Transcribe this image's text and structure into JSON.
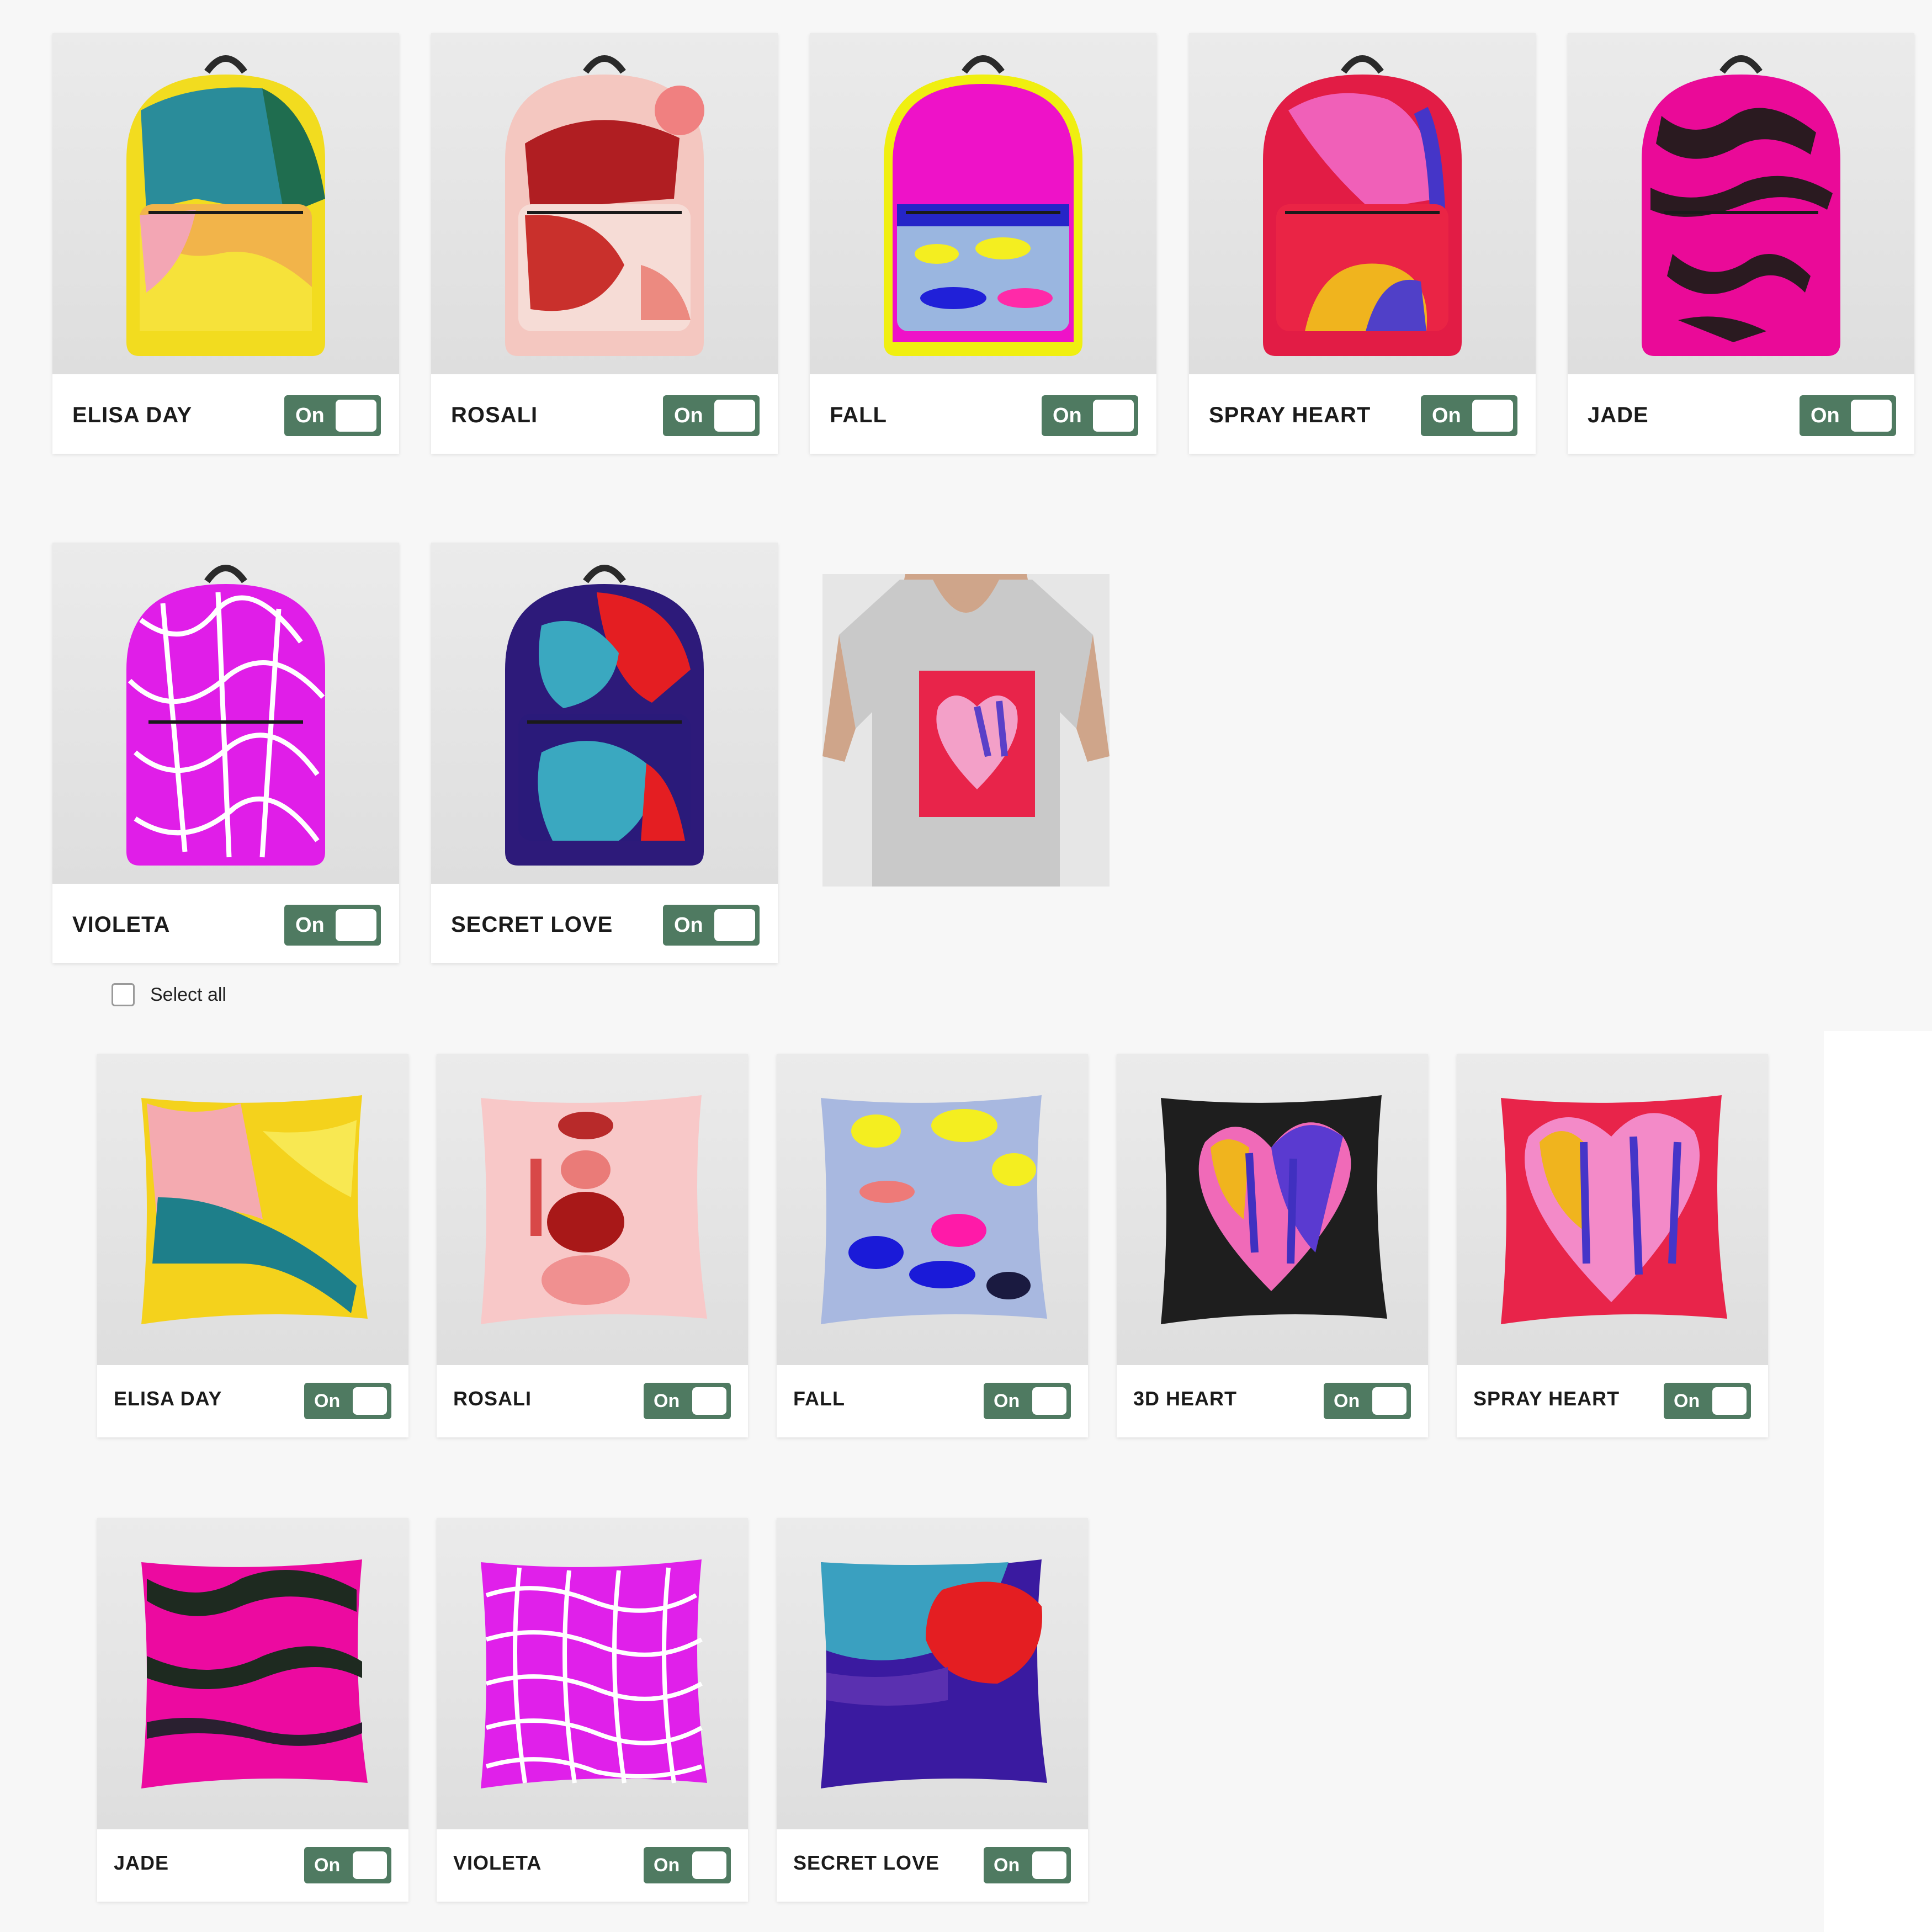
{
  "toggle_label": "On",
  "backpacks": [
    {
      "name": "ELISA DAY",
      "toggle": "On"
    },
    {
      "name": "ROSALI",
      "toggle": "On"
    },
    {
      "name": "FALL",
      "toggle": "On"
    },
    {
      "name": "SPRAY HEART",
      "toggle": "On"
    },
    {
      "name": "JADE",
      "toggle": "On"
    },
    {
      "name": "VIOLETA",
      "toggle": "On"
    },
    {
      "name": "SECRET LOVE",
      "toggle": "On"
    }
  ],
  "select_all": {
    "label": "Select all",
    "checked": false
  },
  "pillows": [
    {
      "name": "ELISA DAY",
      "toggle": "On"
    },
    {
      "name": "ROSALI",
      "toggle": "On"
    },
    {
      "name": "FALL",
      "toggle": "On"
    },
    {
      "name": "3D HEART",
      "toggle": "On"
    },
    {
      "name": "SPRAY HEART",
      "toggle": "On"
    },
    {
      "name": "JADE",
      "toggle": "On"
    },
    {
      "name": "VIOLETA",
      "toggle": "On"
    },
    {
      "name": "SECRET LOVE",
      "toggle": "On"
    }
  ],
  "colors": {
    "toggle_bg": "#4f7a61",
    "page_bg": "#f7f7f7",
    "card_bg": "#ffffff"
  }
}
